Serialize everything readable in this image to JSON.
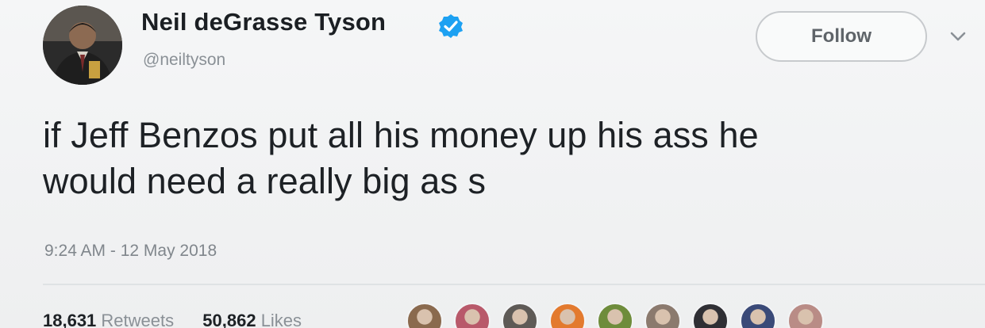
{
  "author": {
    "name": "Neil deGrasse Tyson",
    "handle": "@neiltyson",
    "verified": true
  },
  "follow_button": {
    "label": "Follow"
  },
  "tweet": {
    "line1": "if Jeff Benzos put all his money up his ass he",
    "line2": "would need a really big as s",
    "timestamp": "9:24 AM - 12 May 2018"
  },
  "stats": {
    "retweets_count": "18,631",
    "retweets_label": "Retweets",
    "likes_count": "50,862",
    "likes_label": "Likes"
  },
  "colors": {
    "verified_badge": "#1da1f2",
    "background": "#f2f3f4"
  },
  "icons": {
    "verified": "verified-badge-icon",
    "more": "chevron-down-icon"
  },
  "liker_avatars": [
    {
      "color": "#8a6a4e"
    },
    {
      "color": "#b8596a"
    },
    {
      "color": "#5e5a56"
    },
    {
      "color": "#e37a2e"
    },
    {
      "color": "#6e8c3b"
    },
    {
      "color": "#8b7a6e"
    },
    {
      "color": "#2f2f34"
    },
    {
      "color": "#3a4a78"
    },
    {
      "color": "#b98c86"
    }
  ]
}
